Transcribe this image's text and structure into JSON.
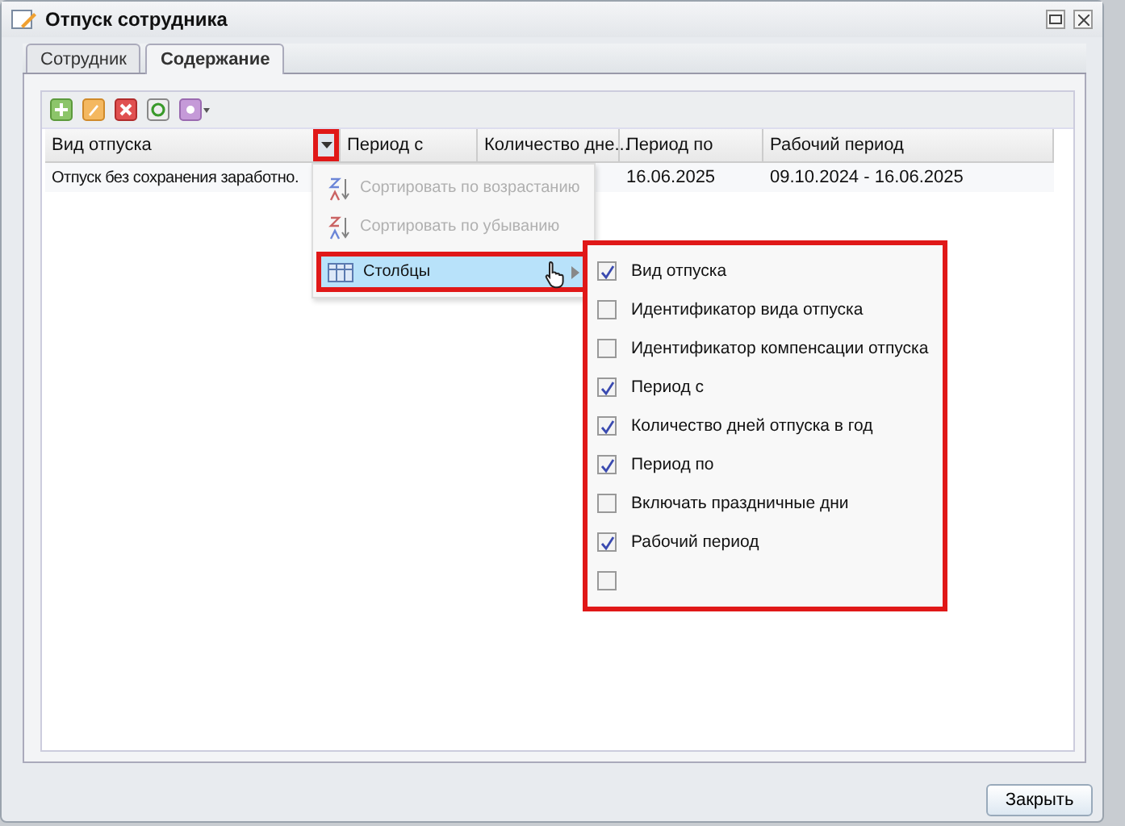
{
  "window": {
    "title": "Отпуск сотрудника"
  },
  "tabs": [
    {
      "label": "Сотрудник",
      "selected": false
    },
    {
      "label": "Содержание",
      "selected": true
    }
  ],
  "toolbar": [
    {
      "kind": "add"
    },
    {
      "kind": "edit"
    },
    {
      "kind": "delete"
    },
    {
      "kind": "refresh"
    },
    {
      "kind": "more"
    }
  ],
  "table": {
    "columns": [
      {
        "label": "Вид отпуска"
      },
      {
        "label": "Период с"
      },
      {
        "label": "Количество дне..."
      },
      {
        "label": "Период по"
      },
      {
        "label": "Рабочий период"
      }
    ],
    "rows": [
      {
        "cells": [
          "Отпуск без сохранения заработно.",
          "",
          "",
          "16.06.2025",
          "09.10.2024 - 16.06.2025"
        ]
      }
    ]
  },
  "column_menu": {
    "trigger_highlighted": true,
    "items": [
      {
        "kind": "sort-asc",
        "label": "Сортировать по возрастанию",
        "disabled": true,
        "selected": false,
        "highlighted": false
      },
      {
        "kind": "sort-desc",
        "label": "Сортировать по убыванию",
        "disabled": true,
        "selected": false,
        "highlighted": false
      },
      {
        "kind": "columns",
        "label": "Столбцы",
        "disabled": false,
        "selected": true,
        "highlighted": true
      }
    ]
  },
  "columns_submenu": {
    "highlighted": true,
    "items": [
      {
        "label": "Вид отпуска",
        "checked": true
      },
      {
        "label": "Идентификатор вида отпуска",
        "checked": false
      },
      {
        "label": "Идентификатор компенсации отпуска",
        "checked": false
      },
      {
        "label": "Период с",
        "checked": true
      },
      {
        "label": "Количество дней отпуска в год",
        "checked": true
      },
      {
        "label": "Период по",
        "checked": true
      },
      {
        "label": "Включать праздничные дни",
        "checked": false
      },
      {
        "label": "Рабочий период",
        "checked": true
      },
      {
        "checked": false
      }
    ]
  },
  "footer": {
    "close_button": "Закрыть"
  }
}
